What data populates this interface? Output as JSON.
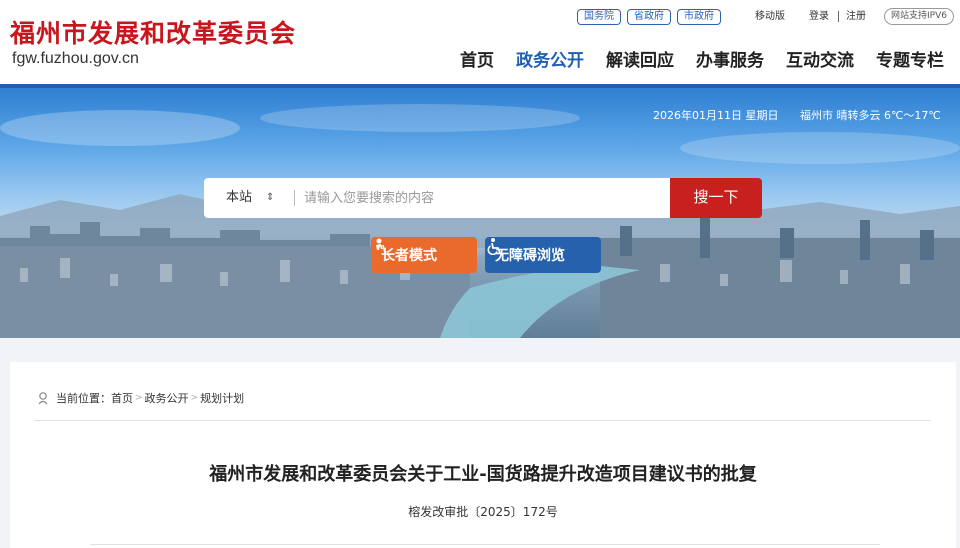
{
  "header": {
    "logo_cn": "福州市发展和改革委员会",
    "logo_en": "fgw.fuzhou.gov.cn",
    "top_links": [
      "国务院",
      "省政府",
      "市政府"
    ],
    "mobile": "移动版",
    "login": "登录",
    "register": "注册",
    "ipv6": "网站支持IPV6",
    "nav": [
      "首页",
      "政务公开",
      "解读回应",
      "办事服务",
      "互动交流",
      "专题专栏"
    ],
    "active_nav": "政务公开"
  },
  "banner": {
    "date": "2026年01月11日 星期日",
    "weather": "福州市 晴转多云 6℃～17℃",
    "search_scope": "本站",
    "search_placeholder": "请输入您要搜索的内容",
    "search_button": "搜一下",
    "elder_mode": "长者模式",
    "accessible_mode": "无障碍浏览"
  },
  "breadcrumb": {
    "label": "当前位置：",
    "items": [
      "首页",
      "政务公开",
      "规划计划"
    ]
  },
  "document": {
    "title": "福州市发展和改革委员会关于工业-国货路提升改造项目建议书的批复",
    "number": "榕发改审批〔2025〕172号"
  },
  "colors": {
    "brand_red": "#c8161d",
    "brand_blue": "#1f5fae",
    "search_red": "#c8201f",
    "elder_orange": "#ea6a2b",
    "access_blue": "#2561ad"
  },
  "icons": [
    "location-icon",
    "elder-icon",
    "wheelchair-icon",
    "select-arrow-icon"
  ]
}
